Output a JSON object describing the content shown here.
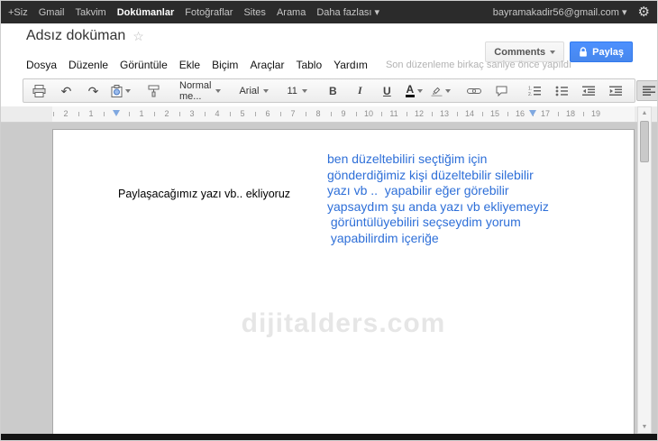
{
  "topbar": {
    "items_before": [
      "+Siz",
      "Gmail",
      "Takvim"
    ],
    "active_item": "Dokümanlar",
    "items_after": [
      "Fotoğraflar",
      "Sites",
      "Arama",
      "Daha fazlası ▾"
    ],
    "email": "bayramakadir56@gmail.com ▾"
  },
  "icons": {
    "gear": "⚙",
    "star": "☆",
    "undo": "↶",
    "redo": "↷",
    "scroll_up": "▲",
    "scroll_down": "▼"
  },
  "header": {
    "title": "Adsız doküman",
    "comments_button": "Comments",
    "share_button": "Paylaş"
  },
  "menubar": {
    "items": [
      "Dosya",
      "Düzenle",
      "Görüntüle",
      "Ekle",
      "Biçim",
      "Araçlar",
      "Tablo",
      "Yardım"
    ],
    "status": "Son düzenleme birkaç saniye önce yapıldı"
  },
  "toolbar": {
    "style_name": "Normal me...",
    "font_name": "Arial",
    "font_size": "11",
    "bold_label": "B",
    "italic_label": "I",
    "underline_label": "U",
    "text_color_label": "A"
  },
  "ruler": {
    "numbers": [
      "2",
      "1",
      "",
      "1",
      "2",
      "3",
      "4",
      "5",
      "6",
      "7",
      "8",
      "9",
      "10",
      "11",
      "12",
      "13",
      "14",
      "15",
      "16",
      "17",
      "18",
      "19"
    ]
  },
  "document": {
    "paragraph_text": "Paylaşacağımız yazı vb..  ekliyoruz",
    "note_text": "ben düzeltebiliri seçtiğim için\ngönderdiğimiz kişi düzeltebilir silebilir\nyazı vb ..  yapabilir eğer görebilir\nyapsaydım şu anda yazı vb ekliyemeyiz\n görüntülüyebiliri seçseydim yorum\n yapabilirdim içeriğe",
    "note_color": "#2e6fd8",
    "watermark": "dijitalders.com"
  }
}
